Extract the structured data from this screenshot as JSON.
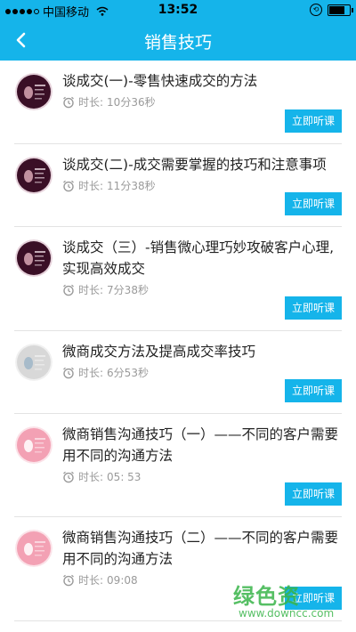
{
  "status_bar": {
    "carrier": "中国移动",
    "time": "13:52",
    "battery_level": 0.85
  },
  "nav": {
    "title": "销售技巧",
    "back_icon": "chevron-left-icon"
  },
  "items": [
    {
      "title": "谈成交(一)-零售快速成交的方法",
      "duration_label": "时长:",
      "duration": "10分36秒",
      "button": "立即听课",
      "avatar_style": "portrait-dark"
    },
    {
      "title": "谈成交(二)-成交需要掌握的技巧和注意事项",
      "duration_label": "时长:",
      "duration": "11分38秒",
      "button": "立即听课",
      "avatar_style": "portrait-dark"
    },
    {
      "title": "谈成交（三）-销售微心理巧妙攻破客户心理, 实现高效成交",
      "duration_label": "时长:",
      "duration": "7分38秒",
      "button": "立即听课",
      "avatar_style": "portrait-dark"
    },
    {
      "title": "微商成交方法及提高成交率技巧",
      "duration_label": "时长:",
      "duration": "6分53秒",
      "button": "立即听课",
      "avatar_style": "light-grey"
    },
    {
      "title": "微商销售沟通技巧（一）——不同的客户需要用不同的沟通方法",
      "duration_label": "时长:",
      "duration": "05: 53",
      "button": "立即听课",
      "avatar_style": "pink"
    },
    {
      "title": "微商销售沟通技巧（二）——不同的客户需要用不同的沟通方法",
      "duration_label": "时长:",
      "duration": "09:08",
      "button": "立即听课",
      "avatar_style": "pink"
    }
  ],
  "watermark": {
    "brand": "绿色资",
    "site": "www.downcc.com"
  },
  "colors": {
    "accent": "#15b4ea",
    "watermark": "#39b54a"
  }
}
